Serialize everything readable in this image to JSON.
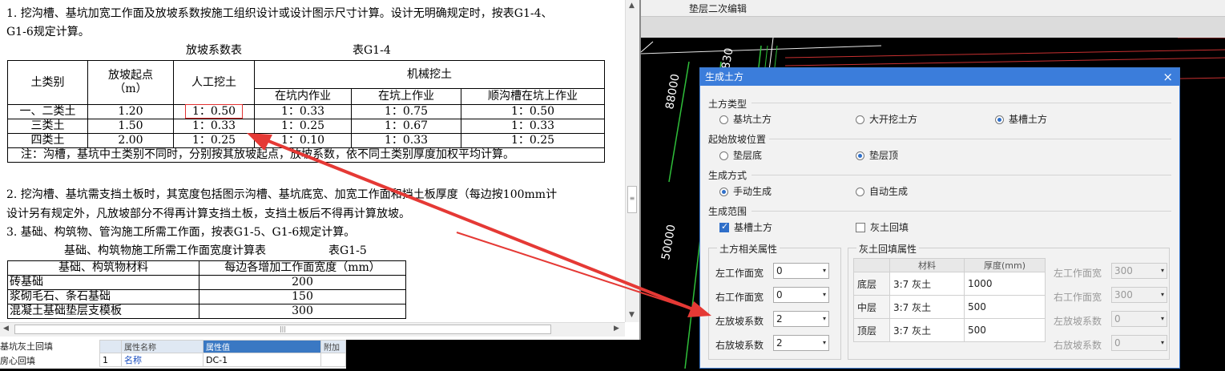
{
  "cad": {
    "toolbar_label": "垫层二次编辑",
    "dim_labels": [
      "88000",
      "50000",
      "830"
    ],
    "colors": {
      "grid_green": "#2fbf3a",
      "grid_red": "#c83030",
      "grid_white": "#e6e6e6"
    }
  },
  "doc": {
    "para1_line1": "1. 挖沟槽、基坑加宽工作面及放坡系数按施工组织设计或设计图示尺寸计算。设计无明确规定时，按表G1-4、",
    "para1_line2": "G1-6规定计算。",
    "table1_caption": "放坡系数表",
    "table1_number": "表G1-4",
    "table1": {
      "h_soil": "土类别",
      "h_start_l1": "放坡起点",
      "h_start_l2": "（m）",
      "h_manual": "人工挖土",
      "h_machine": "机械挖土",
      "h_in_pit": "在坑内作业",
      "h_on_pit": "在坑上作业",
      "h_along": "顺沟槽在坑上作业",
      "rows": [
        {
          "soil": "一、二类土",
          "start": "1.20",
          "manual": "1：0.50",
          "in_pit": "1：0.33",
          "on_pit": "1：0.75",
          "along": "1：0.50"
        },
        {
          "soil": "三类土",
          "start": "1.50",
          "manual": "1：0.33",
          "in_pit": "1：0.25",
          "on_pit": "1：0.67",
          "along": "1：0.33"
        },
        {
          "soil": "四类土",
          "start": "2.00",
          "manual": "1：0.25",
          "in_pit": "1：0.10",
          "on_pit": "1：0.33",
          "along": "1：0.25"
        }
      ],
      "note": "注：沟槽，基坑中土类别不同时，分别按其放坡起点，放坡系数，依不同土类别厚度加权平均计算。"
    },
    "para2_line1": "2. 挖沟槽、基坑需支挡土板时，其宽度包括图示沟槽、基坑底宽、加宽工作面和挡土板厚度（每边按100mm计",
    "para2_line2": "设计另有规定外，凡放坡部分不得再计算支挡土板，支挡土板后不得再计算放坡。",
    "para3": "3. 基础、构筑物、管沟施工所需工作面，按表G1-5、G1-6规定计算。",
    "table2_caption": "基础、构筑物施工所需工作面宽度计算表",
    "table2_number": "表G1-5",
    "table2": {
      "h_material": "基础、构筑物材料",
      "h_width": "每边各增加工作面宽度（mm）",
      "rows": [
        {
          "material": "砖基础",
          "width": "200"
        },
        {
          "material": "浆砌毛石、条石基础",
          "width": "150"
        },
        {
          "material": "混凝土基础垫层支模板",
          "width": "300"
        }
      ]
    },
    "scroll_grip": "≡",
    "hscroll_grip": "|||"
  },
  "prop_panel": {
    "left_items": [
      "基坑灰土回填",
      "房心回填"
    ],
    "h_name": "属性名称",
    "h_value": "属性值",
    "h_extra": "附加",
    "row_num": "1",
    "row_name": "名称",
    "row_value": "DC-1"
  },
  "dialog": {
    "title": "生成土方",
    "close": "×",
    "grp_type": "土方类型",
    "opt_pit": "基坑土方",
    "opt_open": "大开挖土方",
    "opt_trench": "基槽土方",
    "grp_start": "起始放坡位置",
    "opt_bottom": "垫层底",
    "opt_top": "垫层顶",
    "grp_mode": "生成方式",
    "opt_manual": "手动生成",
    "opt_auto": "自动生成",
    "grp_range": "生成范围",
    "chk_trench": "基槽土方",
    "chk_fill": "灰土回填",
    "earth_legend": "土方相关属性",
    "fill_legend": "灰土回填属性",
    "lbl_left_w": "左工作面宽",
    "lbl_right_w": "右工作面宽",
    "lbl_left_s": "左放坡系数",
    "lbl_right_s": "右放坡系数",
    "earth_left_w": "0",
    "earth_right_w": "0",
    "earth_left_s": "2",
    "earth_right_s": "2",
    "fill_h_material": "材料",
    "fill_h_thickness": "厚度(mm)",
    "fill_rows": [
      {
        "layer": "底层",
        "material": "3:7 灰土",
        "thickness": "1000"
      },
      {
        "layer": "中层",
        "material": "3:7 灰土",
        "thickness": "500"
      },
      {
        "layer": "顶层",
        "material": "3:7 灰土",
        "thickness": "500"
      }
    ],
    "fill_left_w": "300",
    "fill_right_w": "300",
    "fill_left_s": "0",
    "fill_right_s": "0"
  },
  "annotation_color": "#e53935"
}
